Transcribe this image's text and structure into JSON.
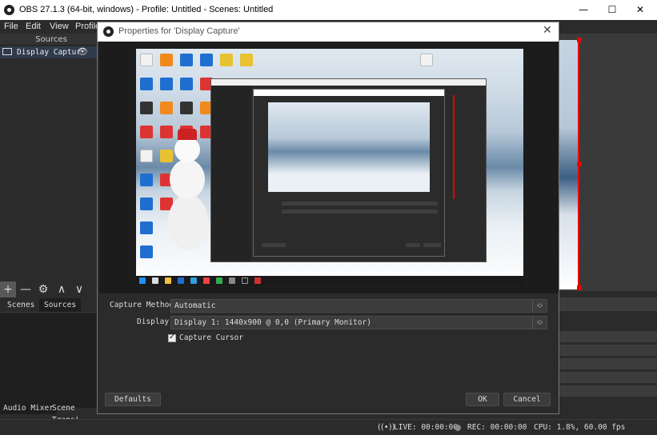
{
  "window": {
    "title": "OBS 27.1.3 (64-bit, windows) - Profile: Untitled - Scenes: Untitled",
    "minimize": "—",
    "maximize": "☐",
    "close": "✕"
  },
  "menu": {
    "file": "File",
    "edit": "Edit",
    "view": "View",
    "profile": "Profile"
  },
  "sources_dock": {
    "header": "Sources",
    "item_label": "Display Captur",
    "eye_icon": "eye-icon"
  },
  "dock_toolbar": {
    "add": "+",
    "remove": "—",
    "settings": "⚙",
    "up": "∧",
    "down": "∨"
  },
  "scene_tabs": {
    "scenes": "Scenes",
    "sources": "Sources"
  },
  "bottom_tabs": {
    "audio_mixer": "Audio Mixer",
    "scene_transitions": "Scene Transi"
  },
  "status": {
    "live": "LIVE: 00:00:00",
    "rec": "REC: 00:00:00",
    "cpu": "CPU: 1.8%, 60.00 fps"
  },
  "dialog": {
    "title": "Properties for 'Display Capture'",
    "close": "✕",
    "capture_method_label": "Capture Method",
    "capture_method_value": "Automatic",
    "display_label": "Display",
    "display_value": "Display 1: 1440x900 @ 0,0 (Primary Monitor)",
    "capture_cursor_label": "Capture Cursor",
    "capture_cursor_checked": true,
    "defaults_button": "Defaults",
    "ok_button": "OK",
    "cancel_button": "Cancel"
  },
  "colors": {
    "accent_red": "#e00000",
    "panel_bg": "#2b2b2b",
    "selected_item": "#2f3b4a"
  }
}
